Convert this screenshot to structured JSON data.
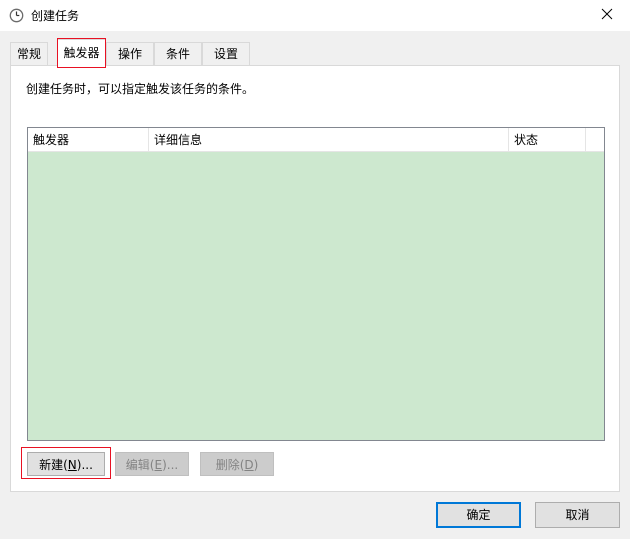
{
  "window": {
    "title": "创建任务",
    "icon": "clock-icon",
    "close": "close-icon"
  },
  "tabs": [
    {
      "label": "常规"
    },
    {
      "label": "触发器",
      "active": true
    },
    {
      "label": "操作"
    },
    {
      "label": "条件"
    },
    {
      "label": "设置"
    }
  ],
  "panel": {
    "description": "创建任务时，可以指定触发该任务的条件。",
    "columns": [
      "触发器",
      "详细信息",
      "状态"
    ],
    "rows": []
  },
  "buttons": {
    "new": {
      "text": "新建(",
      "key": "N",
      "suffix": ")..."
    },
    "edit": {
      "text": "编辑(",
      "key": "E",
      "suffix": ")..."
    },
    "delete": {
      "text": "删除(",
      "key": "D",
      "suffix": ")"
    },
    "ok": "确定",
    "cancel": "取消"
  },
  "colors": {
    "list_background": "#cde8cf",
    "highlight": "#e81123",
    "accent": "#0078d7"
  }
}
